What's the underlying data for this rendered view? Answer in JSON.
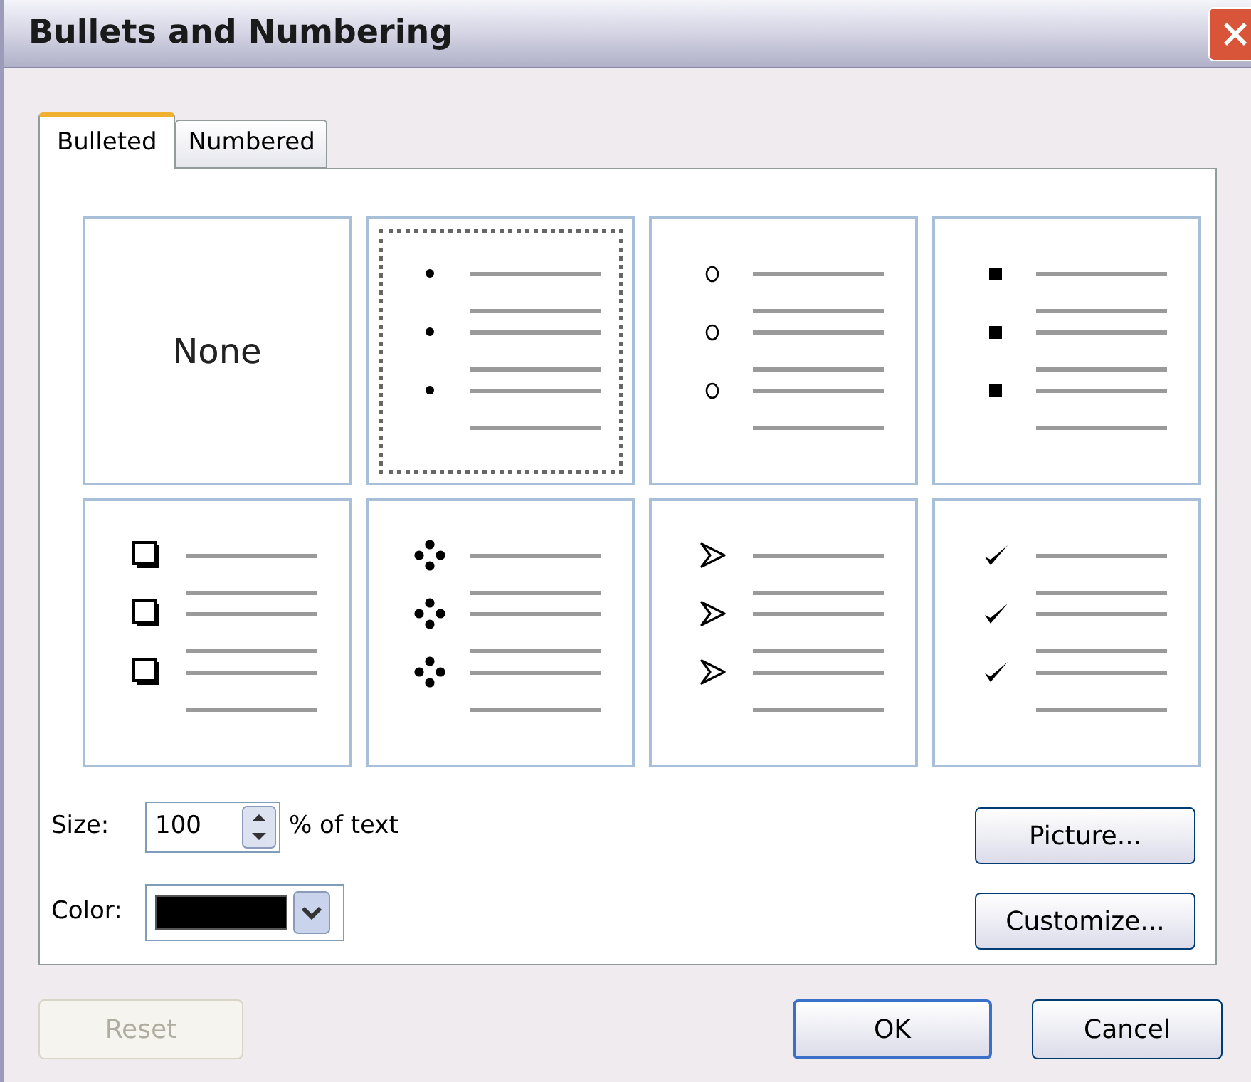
{
  "window": {
    "title": "Bullets and Numbering"
  },
  "tabs": [
    {
      "label": "Bulleted",
      "selected": true
    },
    {
      "label": "Numbered",
      "selected": false
    }
  ],
  "styles": [
    {
      "kind": "none",
      "label": "None",
      "selected": false
    },
    {
      "kind": "dot",
      "selected": true
    },
    {
      "kind": "circle",
      "selected": false
    },
    {
      "kind": "square",
      "selected": false
    },
    {
      "kind": "hollow-square",
      "selected": false
    },
    {
      "kind": "diamond-dots",
      "selected": false
    },
    {
      "kind": "arrow",
      "selected": false
    },
    {
      "kind": "check",
      "selected": false
    }
  ],
  "size": {
    "label": "Size:",
    "value": "100",
    "suffix": "% of text"
  },
  "color": {
    "label": "Color:",
    "color": "#000000"
  },
  "side_buttons": [
    "Picture...",
    "Customize..."
  ],
  "footer": {
    "reset": {
      "label": "Reset",
      "disabled": true
    },
    "ok": "OK",
    "cancel": "Cancel"
  }
}
